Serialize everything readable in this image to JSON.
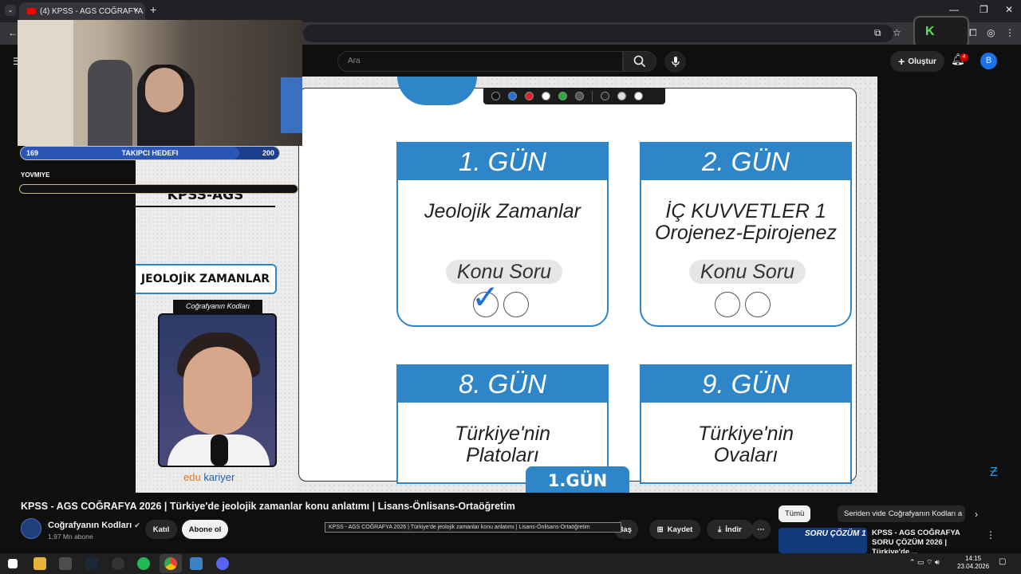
{
  "browser": {
    "tab_title": "(4) KPSS - AGS COĞRAFYA",
    "tab_close": "×",
    "new_tab": "+"
  },
  "youtube": {
    "search_placeholder": "Ara",
    "create_label": "Oluştur",
    "notification_count": "4",
    "avatar_letter": "B"
  },
  "overlay": {
    "follow_current": "169",
    "follow_label": "TAKIPCI HEDEFI",
    "follow_target": "200",
    "follow_progress": 0.845,
    "yovmiye_label": "YOVMIYE"
  },
  "slide": {
    "left_label": "KPSS-AGS",
    "topic_label": "JEOLOJİK ZAMANLAR",
    "presenter_tag": "Coğrafyanın Kodları",
    "logo_edu": "edu",
    "logo_kariyer": "kariyer",
    "cards": [
      {
        "day": "1. GÜN",
        "title": "Jeolojik Zamanlar",
        "sub": "",
        "tag": "Konu Soru",
        "checked": true
      },
      {
        "day": "2. GÜN",
        "title": "İÇ KUVVETLER 1",
        "sub": "Orojenez-Epirojenez",
        "tag": "Konu Soru",
        "checked": false
      },
      {
        "day": "8. GÜN",
        "title": "Türkiye'nin",
        "sub": "Platoları"
      },
      {
        "day": "9. GÜN",
        "title": "Türkiye'nin",
        "sub": "Ovaları"
      }
    ],
    "day_badge": "1.GÜN",
    "check_mark": "✓"
  },
  "video_info": {
    "title": "KPSS - AGS COĞRAFYA 2026 | Türkiye'de jeolojik zamanlar konu anlatımı | Lisans-Önlisans-Ortaöğretim",
    "channel": "Coğrafyanın Kodları",
    "subscribers": "1,97 Mn abone",
    "join": "Katıl",
    "subscribe": "Abone ol",
    "share": "Paylaş",
    "save": "Kaydet",
    "download": "İndir",
    "tooltip": "KPSS - AGS COĞRAFYA 2026 | Türkiye'de jeolojik zamanlar konu anlatımı | Lisans-Önlisans-Ortaöğretim"
  },
  "chips": [
    "Tümü",
    "Seriden videolar",
    "Coğrafyanın Kodları a"
  ],
  "recommendation": {
    "title": "KPSS - AGS COĞRAFYA SORU ÇÖZÜM 2026 | Türkiye'de ...",
    "thumb_text": "SORU ÇÖZÜM 1"
  },
  "taskbar": {
    "time": "14:15",
    "date": "23.04.2026"
  },
  "colors": {
    "slide_blue": "#2e86c8",
    "youtube_red": "#ff0000"
  }
}
